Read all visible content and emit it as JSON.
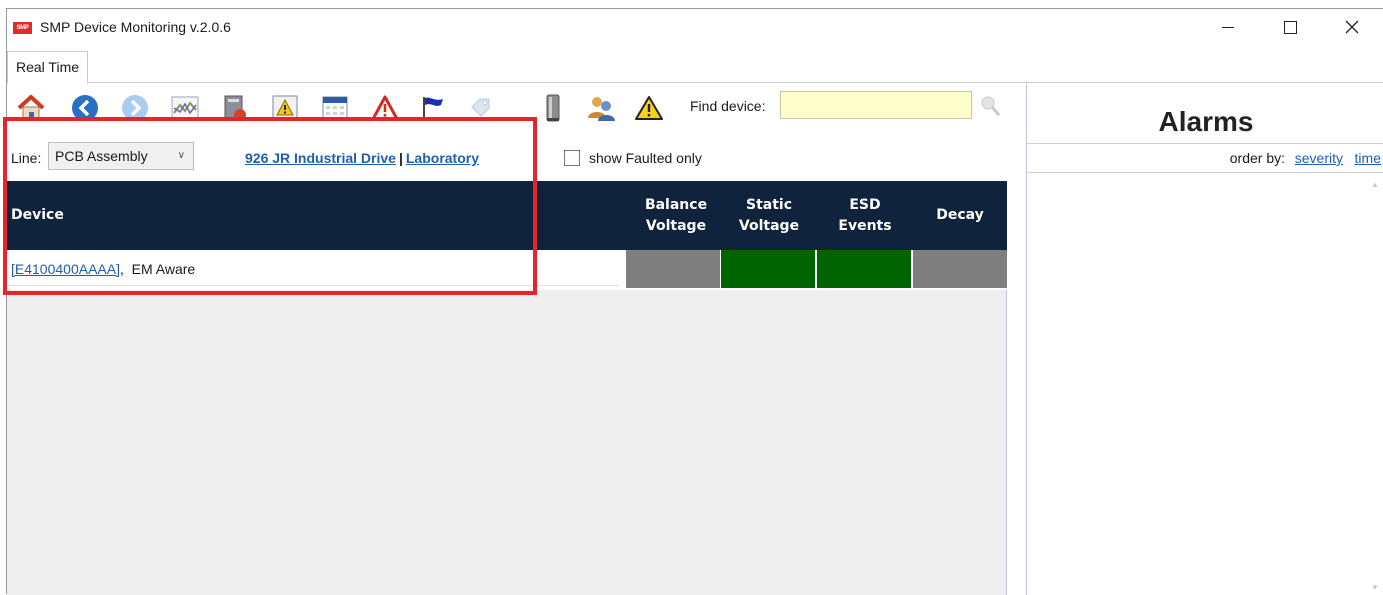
{
  "window": {
    "logo_text": "SMP",
    "title": "SMP Device Monitoring v.2.0.6"
  },
  "tabs": [
    {
      "label": "Real Time"
    }
  ],
  "toolbar": {
    "icons": [
      "home-icon",
      "back-icon",
      "forward-icon",
      "chart-icon",
      "report-icon",
      "alert-report-icon",
      "calendar-icon",
      "alarm-icon",
      "flag-icon",
      "tag-icon",
      "device-icon",
      "users-icon",
      "warning-icon"
    ],
    "find_label": "Find device:",
    "find_value": "",
    "find_button_icon": "search-user-icon"
  },
  "filter": {
    "line_label": "Line:",
    "line_value": "PCB Assembly",
    "address": "926 JR Industrial Drive",
    "separator": "|",
    "location": "Laboratory",
    "show_faulted_label": "show Faulted only",
    "show_faulted_checked": false
  },
  "grid": {
    "columns": {
      "device": "Device",
      "balance": [
        "Balance",
        "Voltage"
      ],
      "static": [
        "Static",
        "Voltage"
      ],
      "esd": [
        "ESD",
        "Events"
      ],
      "decay": "Decay"
    },
    "rows": [
      {
        "device_id": "[E4100400AAAA]",
        "separator": ",",
        "device_type": "EM Aware",
        "statuses": {
          "balance": "#7f7f7f",
          "static": "#006400",
          "esd": "#006400",
          "decay": "#7f7f7f"
        }
      }
    ]
  },
  "alarms": {
    "title": "Alarms",
    "order_by_label": "order by:",
    "order_severity": "severity",
    "order_time": "time"
  },
  "colors": {
    "header_bg": "#0f233d",
    "highlight": "#e5242b",
    "link": "#1e5fb0",
    "find_bg": "#ffffcc"
  }
}
